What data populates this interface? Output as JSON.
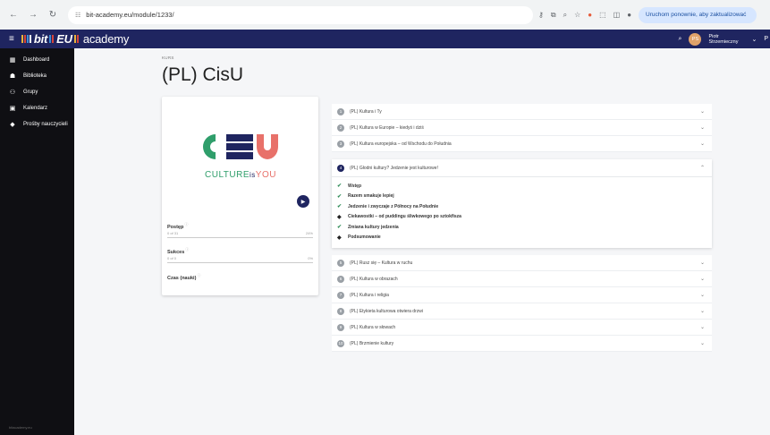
{
  "browser": {
    "url": "bit-academy.eu/module/1233/",
    "reload_button": "Uruchom ponownie, aby zaktualizować"
  },
  "header": {
    "logo_part1": "bit",
    "logo_part2": "EU",
    "logo_part3": "academy",
    "avatar_initials": "PS",
    "user_first": "Piotr",
    "user_last": "Strzemieczny",
    "menu_letter": "P"
  },
  "sidebar": {
    "items": [
      {
        "label": "Dashboard",
        "icon": "dashboard-icon"
      },
      {
        "label": "Biblioteka",
        "icon": "library-icon"
      },
      {
        "label": "Grupy",
        "icon": "groups-icon"
      },
      {
        "label": "Kalendarz",
        "icon": "calendar-icon"
      },
      {
        "label": "Prośby nauczycieli",
        "icon": "teacher-requests-icon"
      }
    ],
    "footer": "bitacademy.eu"
  },
  "main": {
    "kurs_label": "KURS",
    "title": "(PL) CisU",
    "card": {
      "logo_text_a": "CULTURE",
      "logo_text_b": "is",
      "logo_text_c": "YOU",
      "progress_label": "Postęp",
      "progress_sub": "0 of 31",
      "progress_pct": "24%",
      "success_label": "Sukces",
      "success_sub": "0 of 0",
      "success_pct": "0%",
      "time_label": "Czas (nauki)"
    },
    "modules_top": [
      {
        "num": "1",
        "title": "(PL) Kultura i Ty"
      },
      {
        "num": "2",
        "title": "(PL) Kultura w Europie – kiedyś i dziś"
      },
      {
        "num": "3",
        "title": "(PL) Kultura europejska – od Wschodu do Południa"
      }
    ],
    "open_module": {
      "num": "4",
      "title": "(PL) Głodni kultury? Jedzenie jest kulturowe!",
      "lessons": [
        "Wstęp",
        "Razem smakuje lepiej",
        "Jedzenie i zwyczaje z Północy na Południe",
        "Ciekawostki – od puddingu śliwkowego po sztokfisza",
        "Zmiana kultury jedzenia",
        "Podsumowanie"
      ]
    },
    "modules_bottom": [
      {
        "num": "5",
        "title": "(PL) Rusz się – Kultura w ruchu"
      },
      {
        "num": "6",
        "title": "(PL) Kultura w obrazach"
      },
      {
        "num": "7",
        "title": "(PL) Kultura i religia"
      },
      {
        "num": "8",
        "title": "(PL) Etykieta kulturowa otwiera drzwi"
      },
      {
        "num": "9",
        "title": "(PL) Kultura w słowach"
      },
      {
        "num": "10",
        "title": "(PL) Brzmienie kultury"
      }
    ]
  },
  "colors": {
    "header_bg": "#1f2560",
    "cu_green": "#2f9e6b",
    "cu_navy": "#1f2560",
    "cu_red": "#e8716a",
    "logo_stripe_1": "#e8b33c",
    "logo_stripe_2": "#d6443a",
    "logo_stripe_3": "#3c8fd6"
  }
}
